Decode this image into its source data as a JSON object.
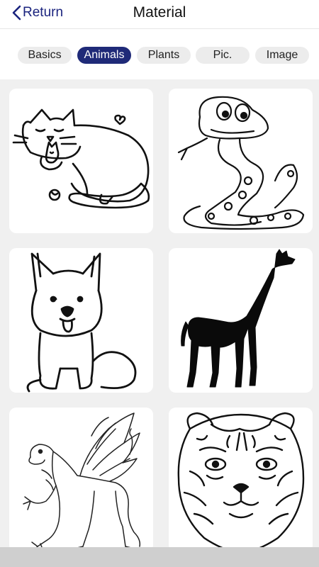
{
  "header": {
    "back_label": "Return",
    "title": "Material"
  },
  "tabs": [
    "Basics",
    "Animals",
    "Plants",
    "Pic.",
    "Image"
  ],
  "active_tab": "Animals",
  "items": [
    "cat",
    "snake",
    "dog",
    "giraffe",
    "griffin",
    "tiger"
  ],
  "colors": {
    "accent": "#1f2a78",
    "tab_bg": "#ececec",
    "grid_bg": "#f0f0f0"
  }
}
